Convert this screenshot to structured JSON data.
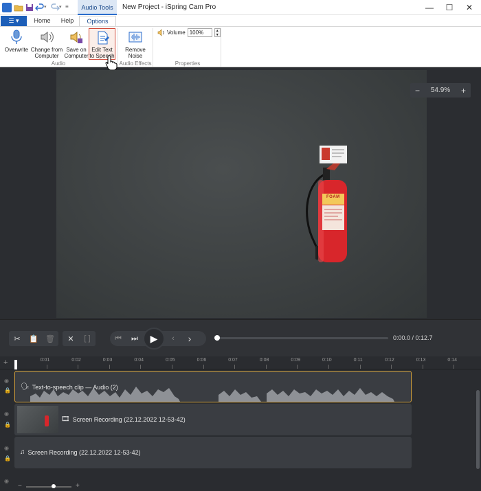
{
  "window": {
    "title": "New Project - iSpring Cam Pro",
    "context_tab": "Audio Tools",
    "controls": {
      "minimize": "—",
      "maximize": "☐",
      "close": "✕"
    }
  },
  "ribbon": {
    "file_tab": "☰ ▾",
    "tabs": [
      "Home",
      "Help",
      "Options"
    ],
    "active_tab": "Options",
    "buttons": {
      "overwrite": "Overwrite",
      "change_from_computer": [
        "Change from",
        "Computer"
      ],
      "save_on_computer": [
        "Save on",
        "Computer"
      ],
      "edit_text_to_speech": [
        "Edit Text",
        "to Speech"
      ],
      "remove_noise": [
        "Remove",
        "Noise"
      ]
    },
    "groups": {
      "audio": "Audio",
      "audio_effects": "Audio Effects",
      "properties": "Properties"
    },
    "volume": {
      "label": "Volume",
      "value": "100%"
    }
  },
  "canvas": {
    "zoom": {
      "minus": "−",
      "value": "54.9%",
      "plus": "+"
    }
  },
  "player": {
    "time": "0:00.0 / 0:12.7",
    "progress": 0
  },
  "timeline": {
    "ticks": [
      "0:01",
      "0:02",
      "0:03",
      "0:04",
      "0:05",
      "0:06",
      "0:07",
      "0:08",
      "0:09",
      "0:10",
      "0:11",
      "0:12",
      "0:13",
      "0:14"
    ],
    "tracks": [
      {
        "label": "Text-to-speech clip — Audio (2)",
        "icon": "speech-icon"
      },
      {
        "label": "Screen Recording (22.12.2022 12-53-42)",
        "icon": "film-icon"
      },
      {
        "label": "Screen Recording (22.12.2022 12-53-42)",
        "icon": "music-note-icon"
      }
    ],
    "zoom_slider": {
      "minus": "−",
      "plus": "+",
      "level": 0.6
    }
  },
  "colors": {
    "accent": "#2b6dcc",
    "selection": "#d4a13a",
    "highlight_border": "#d24b3a",
    "dark_bg": "#2b2d31"
  }
}
